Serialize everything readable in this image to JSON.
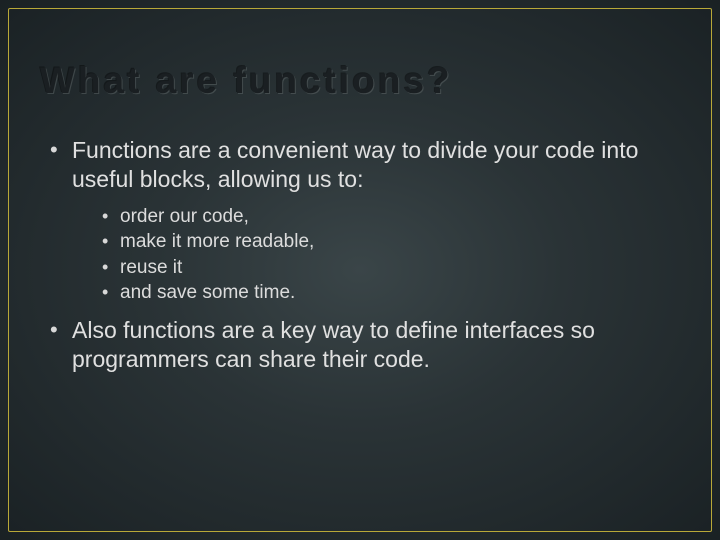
{
  "title": "What are functions?",
  "bullets": [
    {
      "text": "Functions are a convenient way to divide your code into useful blocks, allowing us to:",
      "sub": [
        "order our code,",
        "make it more readable,",
        "reuse it",
        "and save some time."
      ]
    },
    {
      "text": "Also functions are a key way to define interfaces so programmers can share their code.",
      "sub": []
    }
  ]
}
